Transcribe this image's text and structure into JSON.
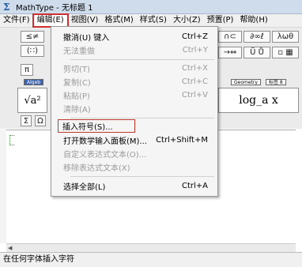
{
  "window": {
    "title": "MathType - 无标题 1",
    "app_icon_glyph": "Σ"
  },
  "menubar": {
    "items": [
      {
        "label": "文件(F)"
      },
      {
        "label": "编辑(E)"
      },
      {
        "label": "视图(V)"
      },
      {
        "label": "格式(M)"
      },
      {
        "label": "样式(S)"
      },
      {
        "label": "大小(Z)"
      },
      {
        "label": "预置(P)"
      },
      {
        "label": "帮助(H)"
      }
    ]
  },
  "toolbar": {
    "row1": [
      "≤≠",
      "(∷)",
      "π",
      "∩⊂",
      "∂∞ℓ",
      "λωθ"
    ],
    "row2": [
      "→⇔",
      "Ũ Ů",
      "▫ ▦"
    ],
    "tabs": [
      "Algeb",
      "Geometry",
      "标签 8"
    ],
    "big_buttons": [
      "√a²",
      "log_a x"
    ],
    "small": [
      "Σ",
      "Ω"
    ]
  },
  "edit_menu": {
    "items": [
      {
        "label": "撤消(U) 键入",
        "shortcut": "Ctrl+Z",
        "disabled": false
      },
      {
        "label": "无法重做",
        "shortcut": "Ctrl+Y",
        "disabled": true
      },
      {
        "label": "剪切(T)",
        "shortcut": "Ctrl+X",
        "disabled": true
      },
      {
        "label": "复制(C)",
        "shortcut": "Ctrl+C",
        "disabled": true
      },
      {
        "label": "粘贴(P)",
        "shortcut": "Ctrl+V",
        "disabled": true
      },
      {
        "label": "清除(A)",
        "shortcut": "",
        "disabled": true
      },
      {
        "label": "插入符号(S)...",
        "shortcut": "",
        "disabled": false
      },
      {
        "label": "打开数学输入面板(M)...",
        "shortcut": "Ctrl+Shift+M",
        "disabled": false
      },
      {
        "label": "自定义表达式文本(O)...",
        "shortcut": "",
        "disabled": true
      },
      {
        "label": "移除表达式文本(X)",
        "shortcut": "",
        "disabled": true
      },
      {
        "label": "选择全部(L)",
        "shortcut": "Ctrl+A",
        "disabled": false
      }
    ]
  },
  "statusbar": {
    "text": "在任何字体插入字符"
  },
  "colors": {
    "highlight_box": "#d03030",
    "titlebar": "#cfdcec",
    "caret": "#2a9a2a"
  }
}
